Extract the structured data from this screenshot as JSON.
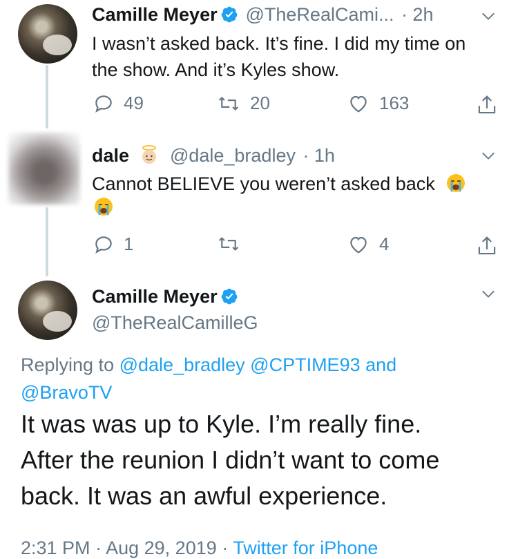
{
  "tweets": [
    {
      "name": "Camille Meyer",
      "handle": "@TheRealCami...",
      "time": "· 2h",
      "text_line1": "I wasn’t asked back. It’s fine. I did my time on",
      "text_line2": "the show. And it’s Kyles show.",
      "replies": "49",
      "retweets": "20",
      "likes": "163",
      "verified": true
    },
    {
      "name": "dale",
      "handle": "@dale_bradley",
      "time": "· 1h",
      "text": "Cannot BELIEVE you weren’t asked back",
      "emoji": [
        "angel-emoji",
        "loudly-crying-emoji",
        "loudly-crying-emoji"
      ],
      "replies": "1",
      "retweets": "",
      "likes": "4"
    }
  ],
  "main_tweet": {
    "name": "Camille Meyer",
    "handle": "@TheRealCamilleG",
    "replying_prefix": "Replying to",
    "mention1": "@dale_bradley",
    "mention2": "@CPTIME93",
    "and_word": "and",
    "mention3": "@BravoTV",
    "text_line1": "It was was up to Kyle. I’m really fine.",
    "text_line2": "After the reunion I didn’t want to come",
    "text_line3": "back. It was an awful experience.",
    "time": "2:31 PM",
    "separator": "·",
    "date": "Aug 29, 2019",
    "source": "Twitter for iPhone"
  },
  "colors": {
    "accent": "#1da1f2",
    "text": "#14171a",
    "muted": "#657786",
    "thread_line": "#cfd9de"
  },
  "icons": [
    "verified-badge-icon",
    "chevron-down-icon",
    "reply-icon",
    "retweet-icon",
    "like-icon",
    "share-icon"
  ]
}
